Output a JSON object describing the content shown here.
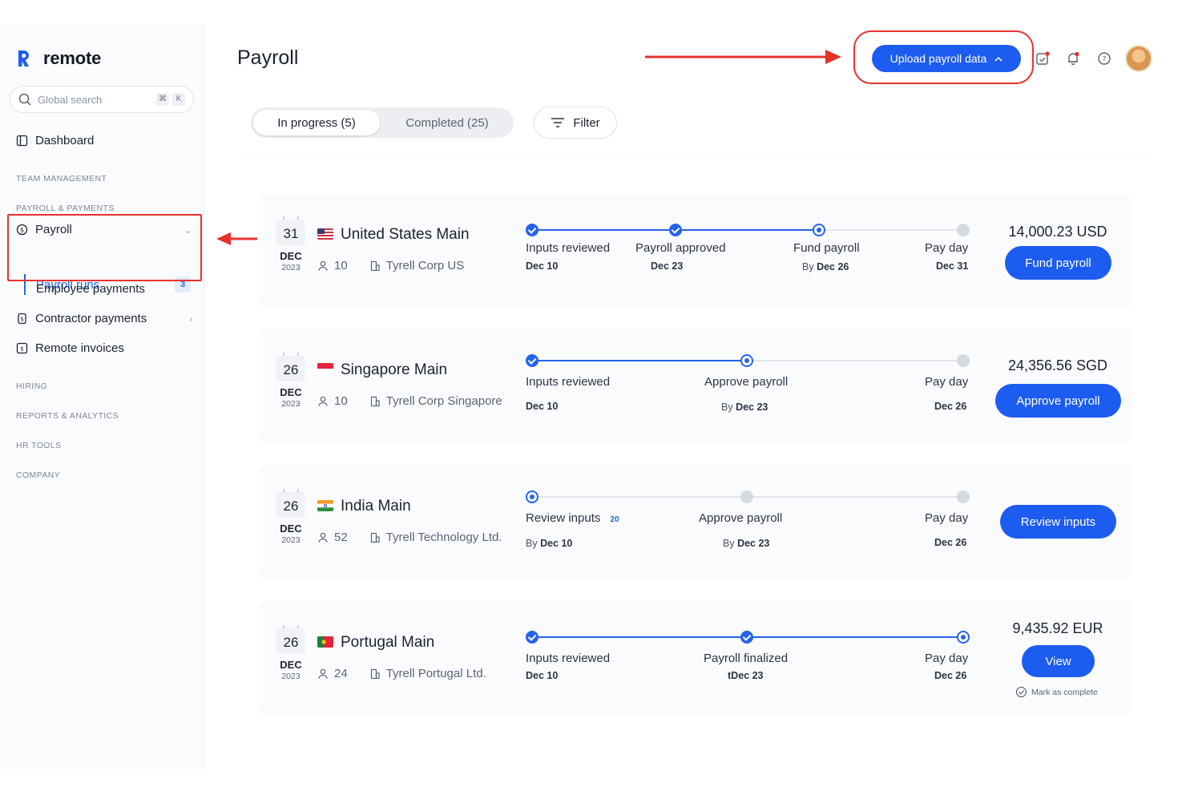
{
  "app": {
    "logo_text": "remote"
  },
  "search": {
    "placeholder": "Global search",
    "kbd": [
      "⌘",
      "K"
    ]
  },
  "nav": {
    "dashboard": "Dashboard",
    "sections": {
      "team_management": "TEAM MANAGEMENT",
      "payroll_payments": "PAYROLL & PAYMENTS",
      "hiring": "HIRING",
      "reports": "REPORTS & ANALYTICS",
      "hr_tools": "HR TOOLS",
      "company": "COMPANY"
    },
    "payroll": "Payroll",
    "payroll_runs": "Payroll runs",
    "payroll_runs_count": "3",
    "employee_payments": "Employee payments",
    "contractor_payments": "Contractor payments",
    "remote_invoices": "Remote invoices"
  },
  "header": {
    "title": "Payroll",
    "upload_button": "Upload payroll data",
    "icons": [
      "calendar-check-icon",
      "bell-icon",
      "help-icon"
    ]
  },
  "tabs": {
    "in_progress": "In progress (5)",
    "completed": "Completed (25)",
    "filter": "Filter"
  },
  "colors": {
    "accent": "#1d5cf0",
    "annotation": "#e5322d"
  },
  "runs": [
    {
      "day": "31",
      "month": "DEC",
      "year": "2023",
      "flag": "us",
      "name": "United States Main",
      "people": "10",
      "entity": "Tyrell Corp US",
      "steps": [
        {
          "label": "Inputs reviewed",
          "date": "Dec 10",
          "prefix": "",
          "status": "done"
        },
        {
          "label": "Payroll approved",
          "date": "Dec 23",
          "prefix": "",
          "status": "done"
        },
        {
          "label": "Fund payroll",
          "date": "Dec 26",
          "prefix": "By ",
          "status": "current"
        },
        {
          "label": "Pay day",
          "date": "Dec 31",
          "prefix": "",
          "status": "todo"
        }
      ],
      "amount": "14,000.23 USD",
      "action": "Fund payroll"
    },
    {
      "day": "26",
      "month": "DEC",
      "year": "2023",
      "flag": "sg",
      "name": "Singapore Main",
      "people": "10",
      "entity": "Tyrell Corp Singapore",
      "steps": [
        {
          "label": "Inputs reviewed",
          "date": "Dec 10",
          "prefix": "",
          "status": "done"
        },
        {
          "label": "Approve payroll",
          "date": "Dec 23",
          "prefix": "By ",
          "status": "current"
        },
        {
          "label": "Pay day",
          "date": "Dec 26",
          "prefix": "",
          "status": "todo"
        }
      ],
      "amount": "24,356.56 SGD",
      "action": "Approve payroll"
    },
    {
      "day": "26",
      "month": "DEC",
      "year": "2023",
      "flag": "in",
      "name": "India Main",
      "people": "52",
      "entity": "Tyrell Technology Ltd.",
      "steps": [
        {
          "label": "Review inputs",
          "badge": "20",
          "date": "Dec 10",
          "prefix": "By ",
          "status": "current"
        },
        {
          "label": "Approve payroll",
          "date": "Dec 23",
          "prefix": "By ",
          "status": "todo"
        },
        {
          "label": "Pay day",
          "date": "Dec 26",
          "prefix": "",
          "status": "todo"
        }
      ],
      "amount": "",
      "action": "Review inputs"
    },
    {
      "day": "26",
      "month": "DEC",
      "year": "2023",
      "flag": "pt",
      "name": "Portugal Main",
      "people": "24",
      "entity": "Tyrell Portugal Ltd.",
      "steps": [
        {
          "label": "Inputs reviewed",
          "date": "Dec 10",
          "prefix": "",
          "status": "done"
        },
        {
          "label": "Payroll finalized",
          "date": "tDec 23",
          "prefix": "",
          "status": "done"
        },
        {
          "label": "Pay day",
          "date": "Dec 26",
          "prefix": "",
          "status": "current"
        }
      ],
      "amount": "9,435.92 EUR",
      "action": "View",
      "mark_complete": "Mark as complete"
    }
  ]
}
